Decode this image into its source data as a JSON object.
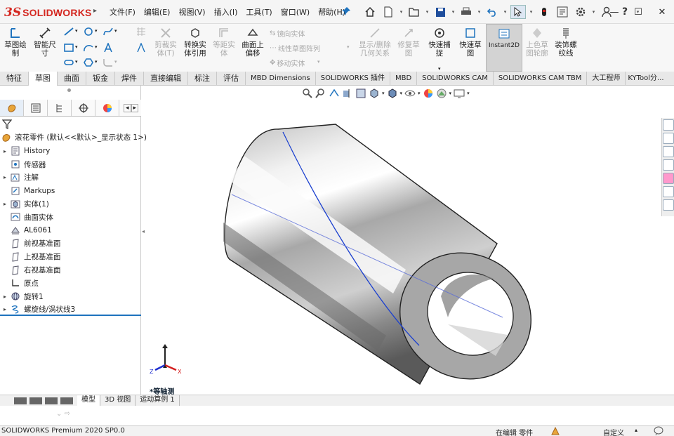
{
  "app": {
    "logo_prefix": "3S",
    "logo_name": "SOLIDWORKS"
  },
  "menus": [
    "文件(F)",
    "编辑(E)",
    "视图(V)",
    "插入(I)",
    "工具(T)",
    "窗口(W)",
    "帮助(H)"
  ],
  "commands": {
    "sketch": "草图绘\n制",
    "smart_dim": "智能尺\n寸",
    "trim": "剪裁实\n体(T)",
    "convert": "转换实\n体引用",
    "offset_entities": "等距实\n体",
    "offset_surface": "曲面上\n偏移",
    "mirror": "镜向实体",
    "linear_pattern": "线性草图阵列",
    "move": "移动实体",
    "display_relations": "显示/删除\n几何关系",
    "repair": "修复草\n图",
    "quick_snaps": "快速捕\n捉",
    "rapid_sketch": "快速草\n图",
    "instant2d": "Instant2D",
    "shaded_sketch": "上色草\n图轮廓",
    "cosmetic_thread": "装饰螺\n纹线"
  },
  "tabs": [
    "特征",
    "草图",
    "曲面",
    "钣金",
    "焊件",
    "直接编辑",
    "标注",
    "评估",
    "MBD Dimensions",
    "SOLIDWORKS 插件",
    "MBD",
    "SOLIDWORKS CAM",
    "SOLIDWORKS CAM TBM",
    "大工程师",
    "KYTool分..."
  ],
  "active_tab": "草图",
  "tree": {
    "root": "滚花零件  (默认<<默认>_显示状态 1>)",
    "items": [
      {
        "label": "History",
        "expand": "▸",
        "icon": "history-icon"
      },
      {
        "label": "传感器",
        "expand": "",
        "icon": "sensors-icon"
      },
      {
        "label": "注解",
        "expand": "▸",
        "icon": "annotations-icon"
      },
      {
        "label": "Markups",
        "expand": "",
        "icon": "markups-icon"
      },
      {
        "label": "实体(1)",
        "expand": "▸",
        "icon": "solid-bodies-icon"
      },
      {
        "label": "曲面实体",
        "expand": "",
        "icon": "surface-bodies-icon"
      },
      {
        "label": "AL6061",
        "expand": "",
        "icon": "material-icon"
      },
      {
        "label": "前视基准面",
        "expand": "",
        "icon": "plane-icon"
      },
      {
        "label": "上视基准面",
        "expand": "",
        "icon": "plane-icon"
      },
      {
        "label": "右视基准面",
        "expand": "",
        "icon": "plane-icon"
      },
      {
        "label": "原点",
        "expand": "",
        "icon": "origin-icon"
      },
      {
        "label": "旋转1",
        "expand": "▸",
        "icon": "revolve-icon"
      },
      {
        "label": "螺旋线/涡状线3",
        "expand": "▸",
        "icon": "helix-icon"
      }
    ]
  },
  "viewport": {
    "view_label": "*等轴测",
    "triad": {
      "x": "X",
      "y": "Y",
      "z": "Z"
    }
  },
  "bottom_tabs": [
    "模型",
    "3D 视图",
    "运动算例 1"
  ],
  "active_bottom_tab": "模型",
  "status": {
    "product": "SOLIDWORKS Premium 2020 SP0.0",
    "mode": "在编辑 零件",
    "units": "自定义"
  },
  "colors": {
    "accent": "#1e73be",
    "logo": "#d4261f",
    "helix": "#1a3fcf"
  }
}
